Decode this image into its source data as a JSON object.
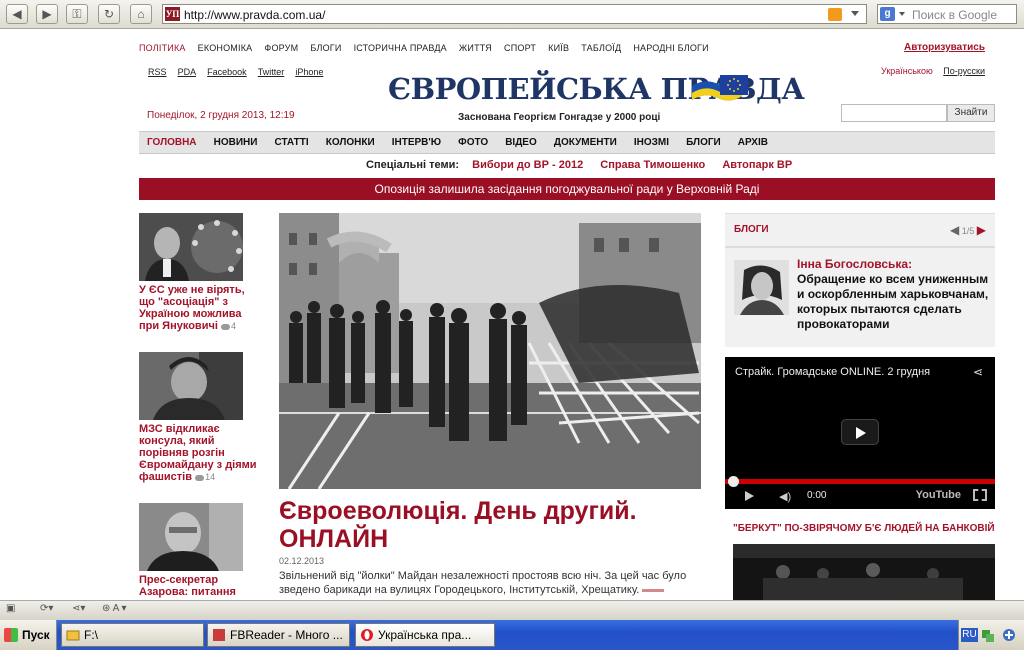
{
  "browser": {
    "url": "http://www.pravda.com.ua/",
    "site_icon_text": "УП",
    "search_placeholder": "Поиск в Google",
    "search_engine_icon": "g-icon"
  },
  "site": {
    "top_nav": [
      "ПОЛІТИКА",
      "ЕКОНОМІКА",
      "ФОРУМ",
      "БЛОГИ",
      "ІСТОРИЧНА ПРАВДА",
      "ЖИТТЯ",
      "СПОРТ",
      "КИЇВ",
      "ТАБЛОЇД",
      "НАРОДНІ БЛОГИ"
    ],
    "auth_link": "Авторизуватись",
    "sub_links": [
      "RSS",
      "PDA",
      "Facebook",
      "Twitter",
      "iPhone"
    ],
    "lang_ua": "Українською",
    "lang_ru": "По-русски",
    "logo": "ЄВРОПЕЙСЬКА ПРАВДА",
    "tagline": "Заснована Георгієм Гонгадзе у 2000 році",
    "date": "Понеділок, 2 грудня 2013, 12:19",
    "search_button": "Знайти",
    "main_nav": [
      "ГОЛОВНА",
      "НОВИНИ",
      "СТАТТІ",
      "КОЛОНКИ",
      "ІНТЕРВ'Ю",
      "ФОТО",
      "ВІДЕО",
      "ДОКУМЕНТИ",
      "ІНОЗМІ",
      "БЛОГИ",
      "АРХІВ"
    ],
    "special_label": "Спеціальні теми:",
    "special_links": [
      "Вибори до ВР - 2012",
      "Справа Тимошенко",
      "Автопарк ВР"
    ],
    "breaking": "Опозиція залишила засідання погоджувальної ради у Верховній Раді"
  },
  "left_news": [
    {
      "caption": "У ЄС уже не вірять, що \"асоціація\" з Україною можлива при Януковичі",
      "comments": "4"
    },
    {
      "caption": "МЗС відкликає консула, який порівняв розгін Євромайдану з діями фашистів",
      "comments": "14"
    },
    {
      "caption": "Прес-секретар Азарова: питання",
      "comments": ""
    }
  ],
  "main": {
    "headline": "Євроеволюція. День другий. ОНЛАЙН",
    "date": "02.12.2013",
    "lead": "Звільнений від \"йолки\" Майдан незалежності простояв всю ніч. За цей час було зведено барикади на вулицях Городецького, Інститутській, Хрещатику."
  },
  "blogs": {
    "title": "БЛОГИ",
    "pager": "1/5",
    "author": "Інна Богословська:",
    "text": "Обращение ко всем униженным и оскорбленным харьковчанам, которых пытаются сделать провокаторами"
  },
  "video": {
    "title": "Страйк. Громадське ONLINE. 2 грудня",
    "time": "0:00",
    "brand": "YouTube"
  },
  "berkut": "\"БЕРКУТ\" ПО-ЗВІРЯЧОМУ Б'Є ЛЮДЕЙ НА БАНКОВІЙ",
  "taskbar": {
    "start": "Пуск",
    "tasks": [
      "F:\\",
      "FBReader - Много ...",
      "Українська пра..."
    ],
    "lang": "RU"
  }
}
